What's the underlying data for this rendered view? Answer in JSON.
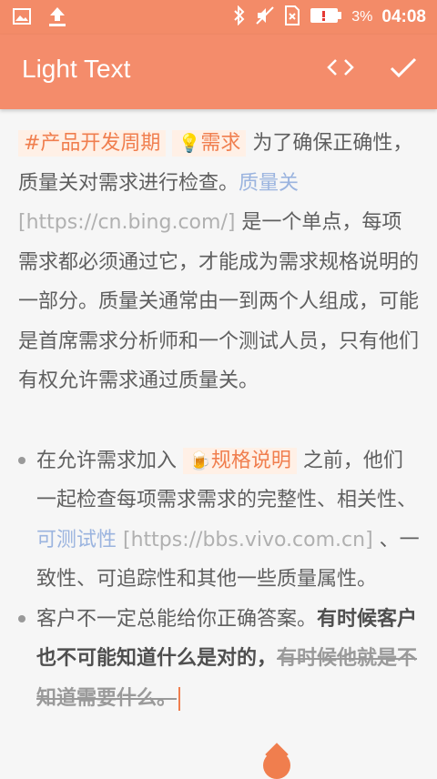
{
  "status_bar": {
    "battery_percent": "3%",
    "time": "04:08",
    "icons": [
      "image-icon",
      "upload-icon",
      "bluetooth-icon",
      "mute-icon",
      "sim-icon",
      "battery-low-icon"
    ]
  },
  "app_bar": {
    "title": "Light Text",
    "actions": [
      "code-toggle-icon",
      "check-icon"
    ]
  },
  "colors": {
    "accent": "#f38b68",
    "tag_bg": "#fff0e6",
    "tag_text": "#f07e4e",
    "link": "#9bb4df"
  },
  "content": {
    "p1": {
      "tag1": "#产品开发周期",
      "tag2_icon": "💡",
      "tag2": "需求",
      "text1": " 为了确保正确性，质量关对需求进行检查。",
      "link": "质量关",
      "url": "[https://cn.bing.com/]",
      "text2": " 是一个单点，每项需求都必须通过它，才能成为需求规格说明的一部分。质量关通常由一到两个人组成，可能是首席需求分析师和一个测试人员，只有他们有权允许需求通过质量关。"
    },
    "bullet1": {
      "text1": "在允许需求加入 ",
      "tag_icon": "🍺",
      "tag": "规格说明",
      "text2": "  之前，他们一起检查每项需求需求的完整性、相关性、",
      "link": "可测试性",
      "url": " [https://bbs.vivo.com.cn]",
      "text3": " 、一致性、可追踪性和其他一些质量属性。"
    },
    "bullet2": {
      "text1": "客户不一定总能给你正确答案。",
      "bold": "有时候客户也不可能知道什么是对的，",
      "strike": "有时候他就是不知道需要什么。"
    }
  }
}
